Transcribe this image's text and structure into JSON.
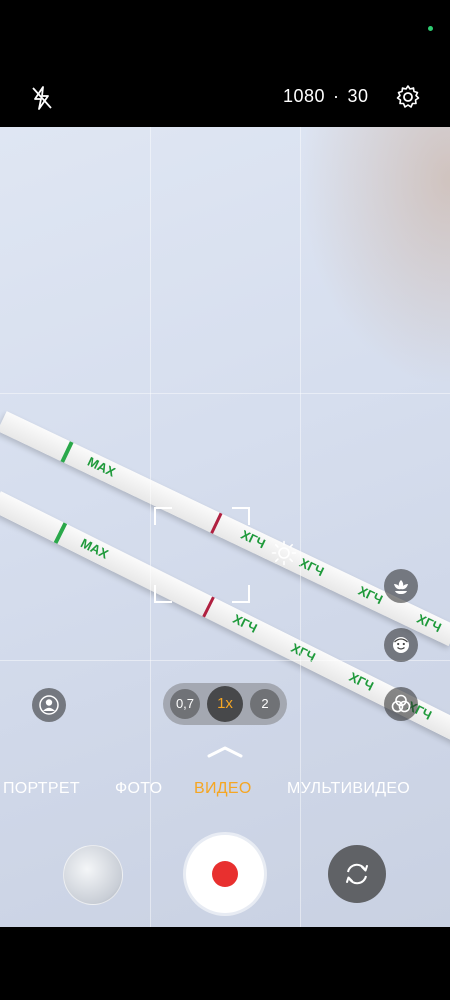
{
  "status_bar": {
    "dot_color": "#2ecc71"
  },
  "top_bar": {
    "flash_icon": "flash-off-icon",
    "resolution": "1080",
    "separator": "·",
    "fps": "30",
    "settings_icon": "gear-icon"
  },
  "viewfinder": {
    "strip_labels": {
      "max": "MAX",
      "hcg": "ХГЧ"
    },
    "focus_icon": "focus-frame-icon",
    "exposure_icon": "sun-icon"
  },
  "side_controls": [
    {
      "name": "flower-icon"
    },
    {
      "name": "face-retouch-icon"
    },
    {
      "name": "filters-icon"
    }
  ],
  "portrait_effect_icon": "portrait-effect-icon",
  "zoom": {
    "options": [
      "0,7",
      "1x",
      "2"
    ],
    "selected": "1x",
    "selected_color": "#f5a623"
  },
  "modes": {
    "items": [
      "ПОРТРЕТ",
      "ФОТО",
      "ВИДЕО",
      "МУЛЬТИВИДЕО"
    ],
    "active": "ВИДЕО",
    "active_color": "#f5a623"
  },
  "bottom": {
    "gallery_icon": "gallery-thumbnail",
    "record_icon": "record-icon",
    "record_color": "#e8302f",
    "switch_icon": "switch-camera-icon"
  }
}
